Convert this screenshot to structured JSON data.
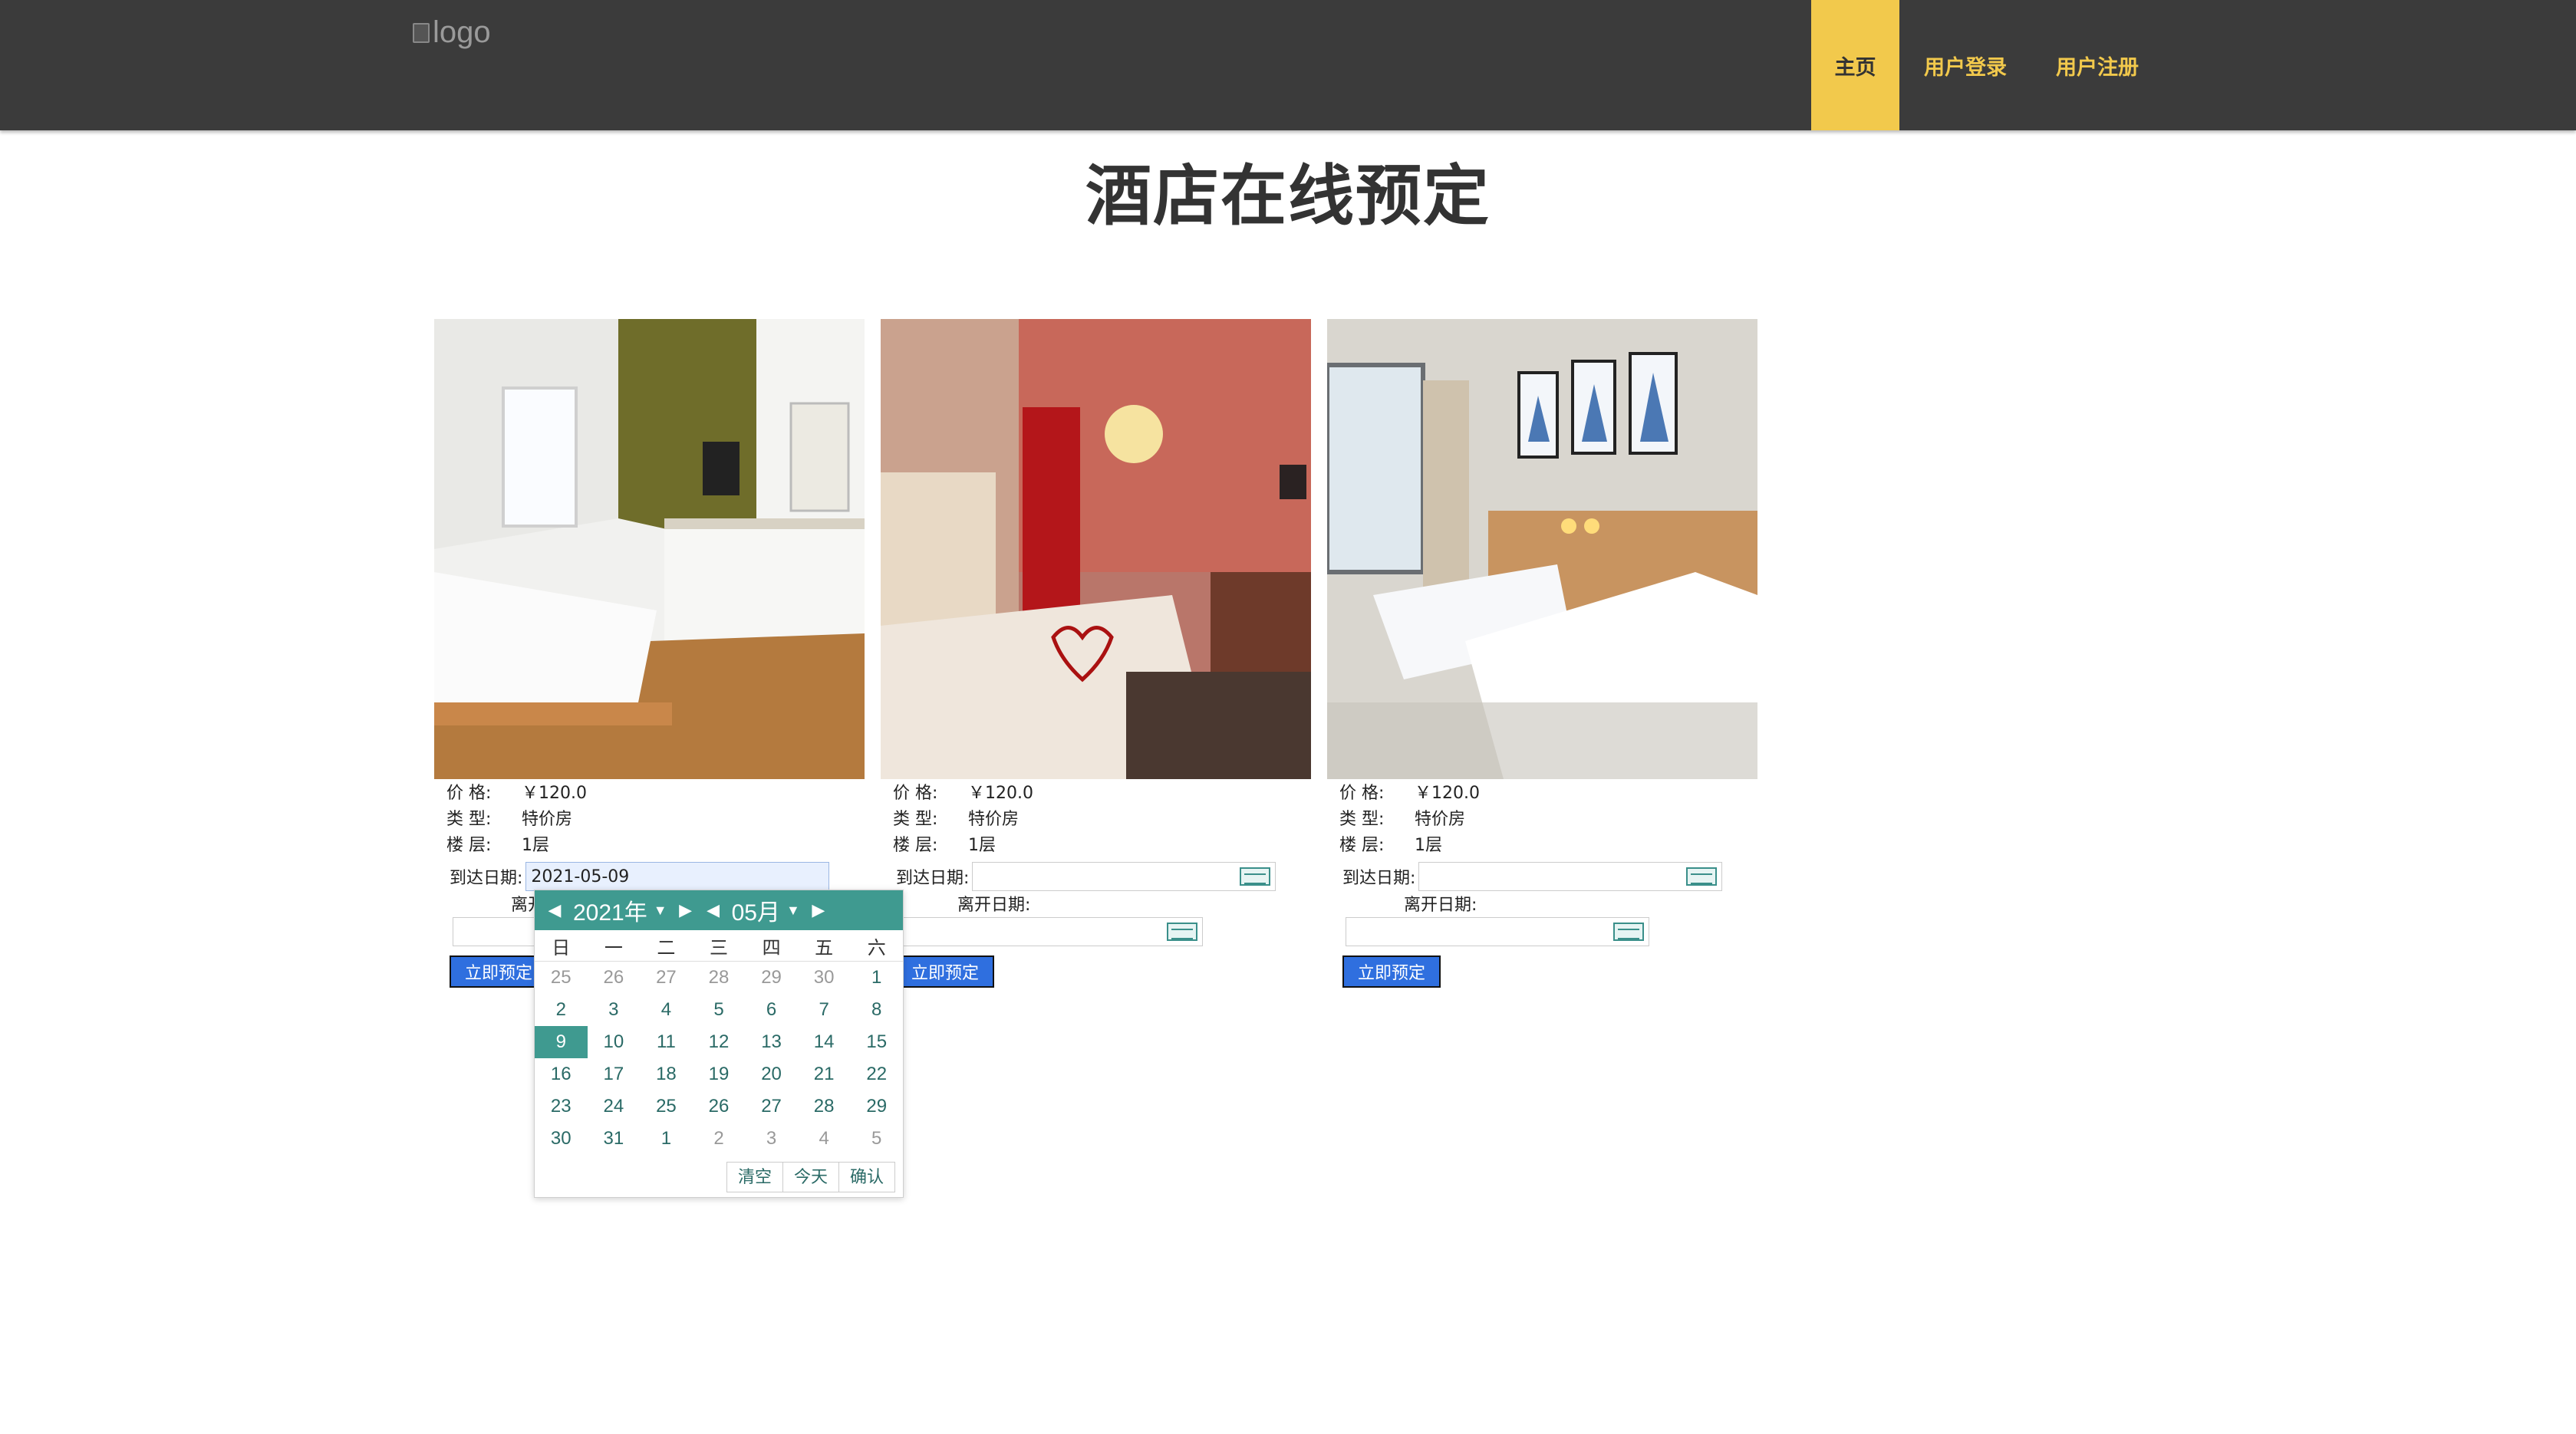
{
  "header": {
    "logo_alt": "logo",
    "nav": [
      {
        "label": "主页",
        "active": true
      },
      {
        "label": "用户登录"
      },
      {
        "label": "用户注册"
      }
    ]
  },
  "page_title": "酒店在线预定",
  "labels": {
    "price": "价 格:",
    "type": "类 型:",
    "floor": "楼 层:",
    "arrive": "到达日期:",
    "leave": "离开日期:",
    "book": "立即预定"
  },
  "rooms": [
    {
      "price": "￥120.0",
      "type": "特价房",
      "floor": "1层",
      "arrive_value": "2021-05-09"
    },
    {
      "price": "￥120.0",
      "type": "特价房",
      "floor": "1层",
      "arrive_value": ""
    },
    {
      "price": "￥120.0",
      "type": "特价房",
      "floor": "1层",
      "arrive_value": ""
    }
  ],
  "calendar": {
    "year": "2021年",
    "month": "05月",
    "weekdays": [
      "日",
      "一",
      "二",
      "三",
      "四",
      "五",
      "六"
    ],
    "days": [
      "25",
      "26",
      "27",
      "28",
      "29",
      "30",
      "1",
      "2",
      "3",
      "4",
      "5",
      "6",
      "7",
      "8",
      "9",
      "10",
      "11",
      "12",
      "13",
      "14",
      "15",
      "16",
      "17",
      "18",
      "19",
      "20",
      "21",
      "22",
      "23",
      "24",
      "25",
      "26",
      "27",
      "28",
      "29",
      "30",
      "31",
      "1",
      "2",
      "3",
      "4",
      "5"
    ],
    "selected_day": "9",
    "buttons": {
      "clear": "清空",
      "today": "今天",
      "confirm": "确认"
    }
  },
  "colors": {
    "nav_bg": "#3b3b3b",
    "accent": "#f2c94c",
    "calendar_teal": "#3f9a90",
    "button_blue": "#2f6fdf"
  }
}
